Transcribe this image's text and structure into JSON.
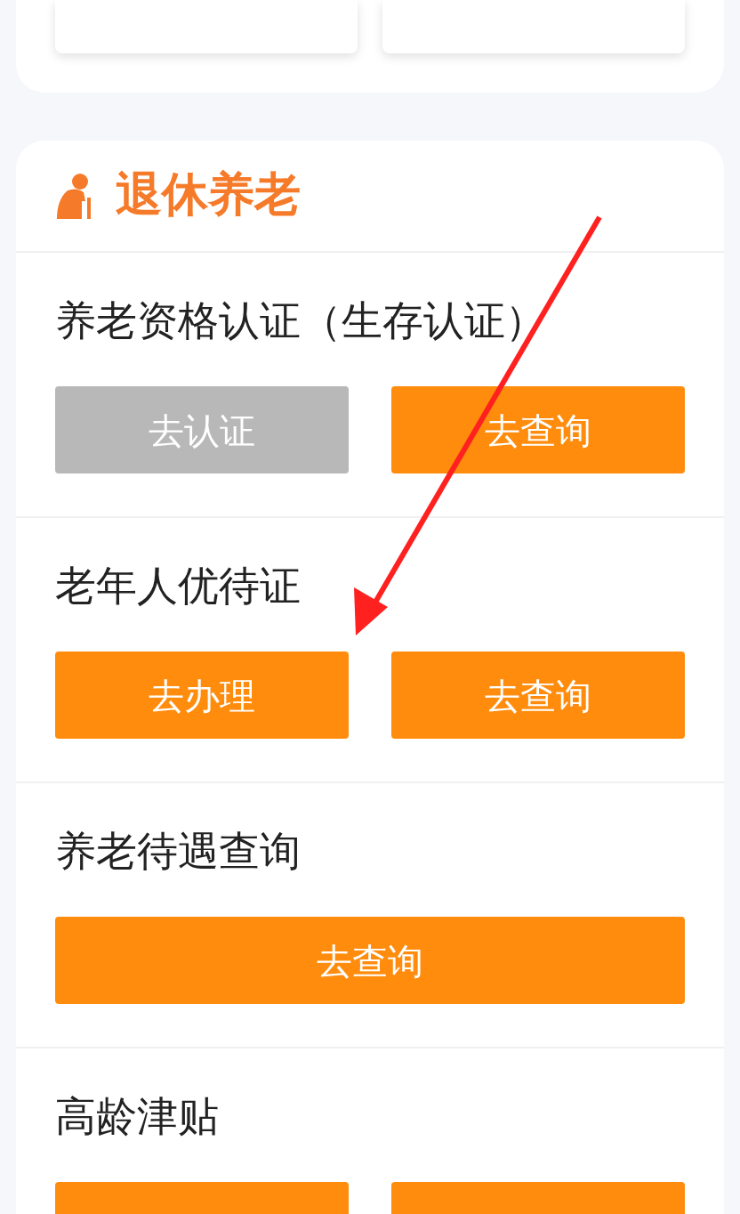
{
  "top_tiles": [
    {
      "kind": "tile"
    },
    {
      "kind": "tile"
    }
  ],
  "section": {
    "title": "退休养老",
    "items": [
      {
        "title": "养老资格认证（生存认证）",
        "buttons": [
          {
            "label": "去认证",
            "disabled": true
          },
          {
            "label": "去查询",
            "disabled": false
          }
        ]
      },
      {
        "title": "老年人优待证",
        "buttons": [
          {
            "label": "去办理",
            "disabled": false
          },
          {
            "label": "去查询",
            "disabled": false
          }
        ]
      },
      {
        "title": "养老待遇查询",
        "buttons": [
          {
            "label": "去查询",
            "disabled": false
          }
        ]
      },
      {
        "title": "高龄津贴",
        "buttons": [
          {
            "disabled": false
          },
          {
            "disabled": false
          }
        ]
      }
    ]
  },
  "annotation": {
    "kind": "arrow"
  }
}
